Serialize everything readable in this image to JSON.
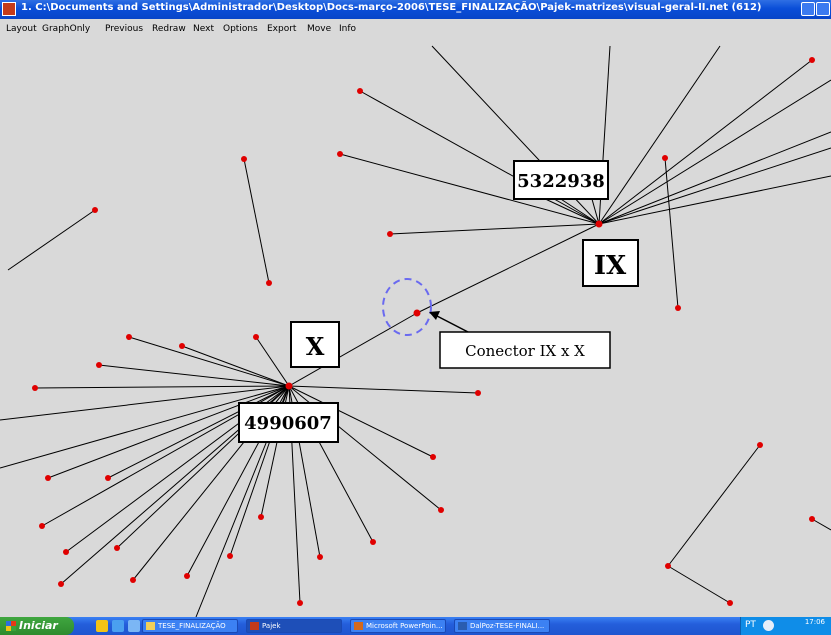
{
  "window": {
    "title": "1. C:\\Documents and Settings\\Administrador\\Desktop\\Docs-março-2006\\TESE_FINALIZAÇÃO\\Pajek-matrizes\\visual-geral-II.net (612)"
  },
  "menu": [
    "Layout",
    "GraphOnly",
    "Previous",
    "Redraw",
    "Next",
    "Options",
    "Export",
    "Move",
    "Info"
  ],
  "annotations": {
    "label_5322938": "5322938",
    "label_ix": "IX",
    "label_x": "X",
    "label_4990607": "4990607",
    "label_connector": "Conector IX x X"
  },
  "colors": {
    "node": "#e00000",
    "edge": "#000000",
    "highlight": "#6a6af0",
    "background": "#d9d9d9"
  },
  "taskbar": {
    "start_label": "Iniciar",
    "tasks": [
      "TESE_FINALIZAÇÃO",
      "Pajek",
      "Microsoft PowerPoin...",
      "DalPoz-TESE-FINALI..."
    ],
    "language": "PT",
    "clock": "17:06"
  }
}
